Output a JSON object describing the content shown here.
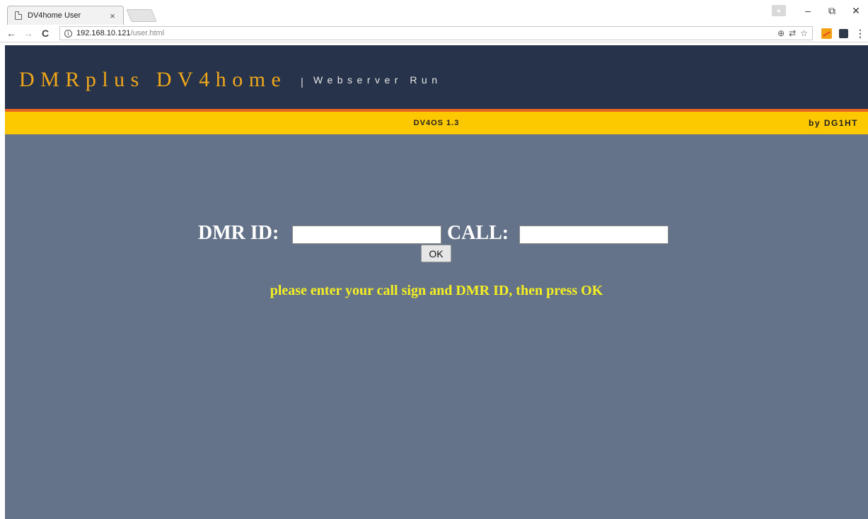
{
  "browser": {
    "tab_title": "DV4home User",
    "tab_close": "×",
    "url_host": "192.168.10.121",
    "url_path": "/user.html",
    "info_icon": "i",
    "zoom_icon": "⊕",
    "translate_icon": "⇄",
    "star_icon": "☆",
    "menu_icon": "⋮",
    "back_icon": "←",
    "forward_icon": "→",
    "reload_icon": "C",
    "minimize_icon": "–",
    "restore_icon": "⧉",
    "close_icon": "✕",
    "profile_icon": "●"
  },
  "header": {
    "brand": "DMRplus DV4home",
    "separator": "|",
    "tagline": "Webserver Run"
  },
  "status_bar": {
    "version": "DV4OS 1.3",
    "author": "by DG1HT"
  },
  "form": {
    "dmr_id_label": "DMR ID:",
    "dmr_id_value": "",
    "call_label": "CALL:",
    "call_value": "",
    "ok_label": "OK",
    "hint": "please enter your call sign and DMR ID, then press OK"
  },
  "colors": {
    "header_bg": "#26334a",
    "brand_text": "#f0a71a",
    "accent_line": "#e46524",
    "status_bar_bg": "#fcc800",
    "content_bg": "#647389",
    "hint_text": "#f5ef22"
  }
}
